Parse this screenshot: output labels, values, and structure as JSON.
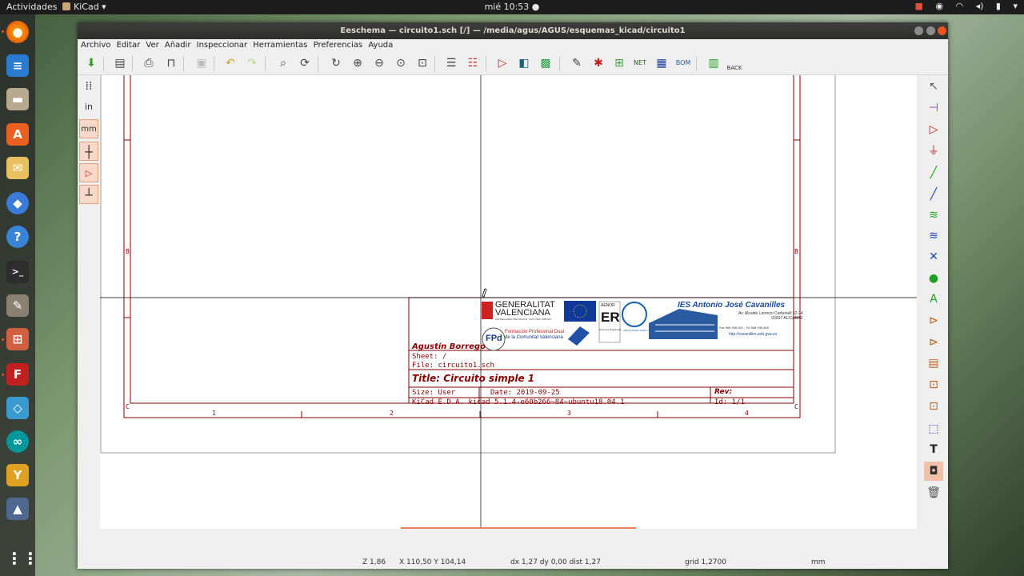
{
  "topbar": {
    "activities": "Actividades",
    "app_name": "KiCad",
    "clock": "mié 10:53"
  },
  "window": {
    "title": "Eeschema — circuito1.sch [/] — /media/agus/AGUS/esquemas_kicad/circuito1"
  },
  "menu": [
    "Archivo",
    "Editar",
    "Ver",
    "Añadir",
    "Inspeccionar",
    "Herramientas",
    "Preferencias",
    "Ayuda"
  ],
  "left_tools": {
    "inches_label": "in",
    "mm_label": "mm"
  },
  "toolbar": {
    "back_label": "BACK",
    "net_label": "NET",
    "bom_label": "BOM"
  },
  "right_tools": {
    "label_text_icon": "A",
    "text_tool": "T"
  },
  "frame": {
    "row_b": "B",
    "row_c": "C",
    "col_1": "1",
    "col_2": "2",
    "col_3": "3",
    "col_4": "4"
  },
  "title_block": {
    "author": "Agustín Borrego",
    "sheet": "Sheet: /",
    "file": "File: circuito1.sch",
    "title": "Title: Circuito simple 1",
    "size": "Size: User",
    "date": "Date: 2019-09-25",
    "rev": "Rev:",
    "kicad": "KiCad E.D.A.  kicad 5.1.4-e60b266~84~ubuntu18.04.1",
    "id": "Id: 1/1"
  },
  "logos": {
    "generalitat_1": "GENERALITAT",
    "generalitat_2": "VALENCIANA",
    "generalitat_sub": "CONSELLERIA D'EDUCACIÓ, CULTURA I ESPORT",
    "fp": "FPd",
    "fp_text_1": "Formación Profesional Dual",
    "fp_text_2": "de la Comunitat Valenciana",
    "aenor": "AENOR",
    "aenor_er": "ER",
    "aenor_sub": "Empresa Registrada",
    "fct": "CERTIFICADO PARA F.C.T.",
    "ies_name": "IES Antonio José Cavanilles",
    "ies_addr_1": "Av. Alcalde Lorenzo Carbonell 32-34",
    "ies_addr_2": "03007 ALICANTE",
    "ies_phone": "Fax 968 936 501 - Tel 968 936 800",
    "ies_web": "http://cavanilles.edu.gva.es"
  },
  "status": {
    "zoom": "Z 1,86",
    "coords": "X 110,50  Y 104,14",
    "delta": "dx 1,27  dy 0,00  dist 1,27",
    "grid": "grid 1,2700",
    "units": "mm"
  },
  "colors": {
    "frame": "#840000",
    "accent": "#e95420"
  }
}
